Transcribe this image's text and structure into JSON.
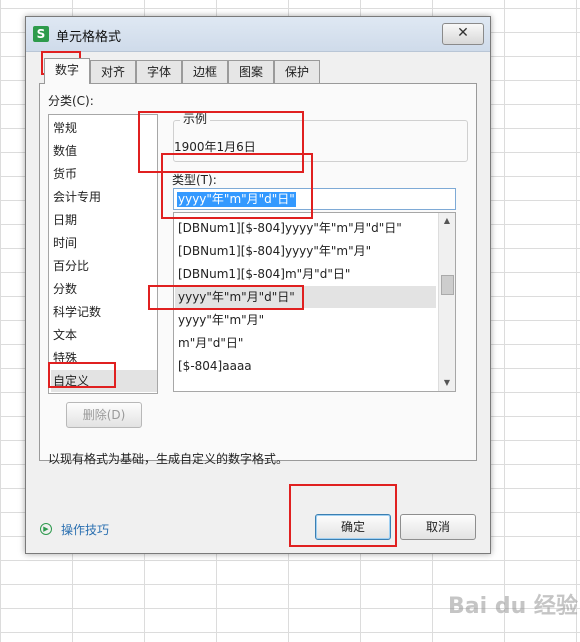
{
  "dialog": {
    "app_icon_letter": "S",
    "title": "单元格格式",
    "close_glyph": "✕",
    "tabs": [
      {
        "label": "数字",
        "active": true
      },
      {
        "label": "对齐"
      },
      {
        "label": "字体"
      },
      {
        "label": "边框"
      },
      {
        "label": "图案"
      },
      {
        "label": "保护"
      }
    ],
    "category_label": "分类(C):",
    "categories": [
      "常规",
      "数值",
      "货币",
      "会计专用",
      "日期",
      "时间",
      "百分比",
      "分数",
      "科学记数",
      "文本",
      "特殊",
      "自定义"
    ],
    "selected_category": "自定义",
    "sample": {
      "legend": "示例",
      "value": "1900年1月6日"
    },
    "type_label": "类型(T):",
    "type_value": "yyyy\"年\"m\"月\"d\"日\"",
    "formats": [
      "[DBNum1][$-804]yyyy\"年\"m\"月\"d\"日\"",
      "[DBNum1][$-804]yyyy\"年\"m\"月\"",
      "[DBNum1][$-804]m\"月\"d\"日\"",
      "yyyy\"年\"m\"月\"d\"日\"",
      "yyyy\"年\"m\"月\"",
      "m\"月\"d\"日\"",
      "[$-804]aaaa"
    ],
    "selected_format_index": 3,
    "delete_button": "删除(D)",
    "description": "以现有格式为基础，生成自定义的数字格式。",
    "tips_link": "操作技巧",
    "ok_button": "确定",
    "cancel_button": "取消"
  },
  "watermark": "Bai du 经验",
  "accent_colors": {
    "selection": "#3399ff",
    "annotation": "#e02020",
    "link": "#2a6fb0"
  }
}
